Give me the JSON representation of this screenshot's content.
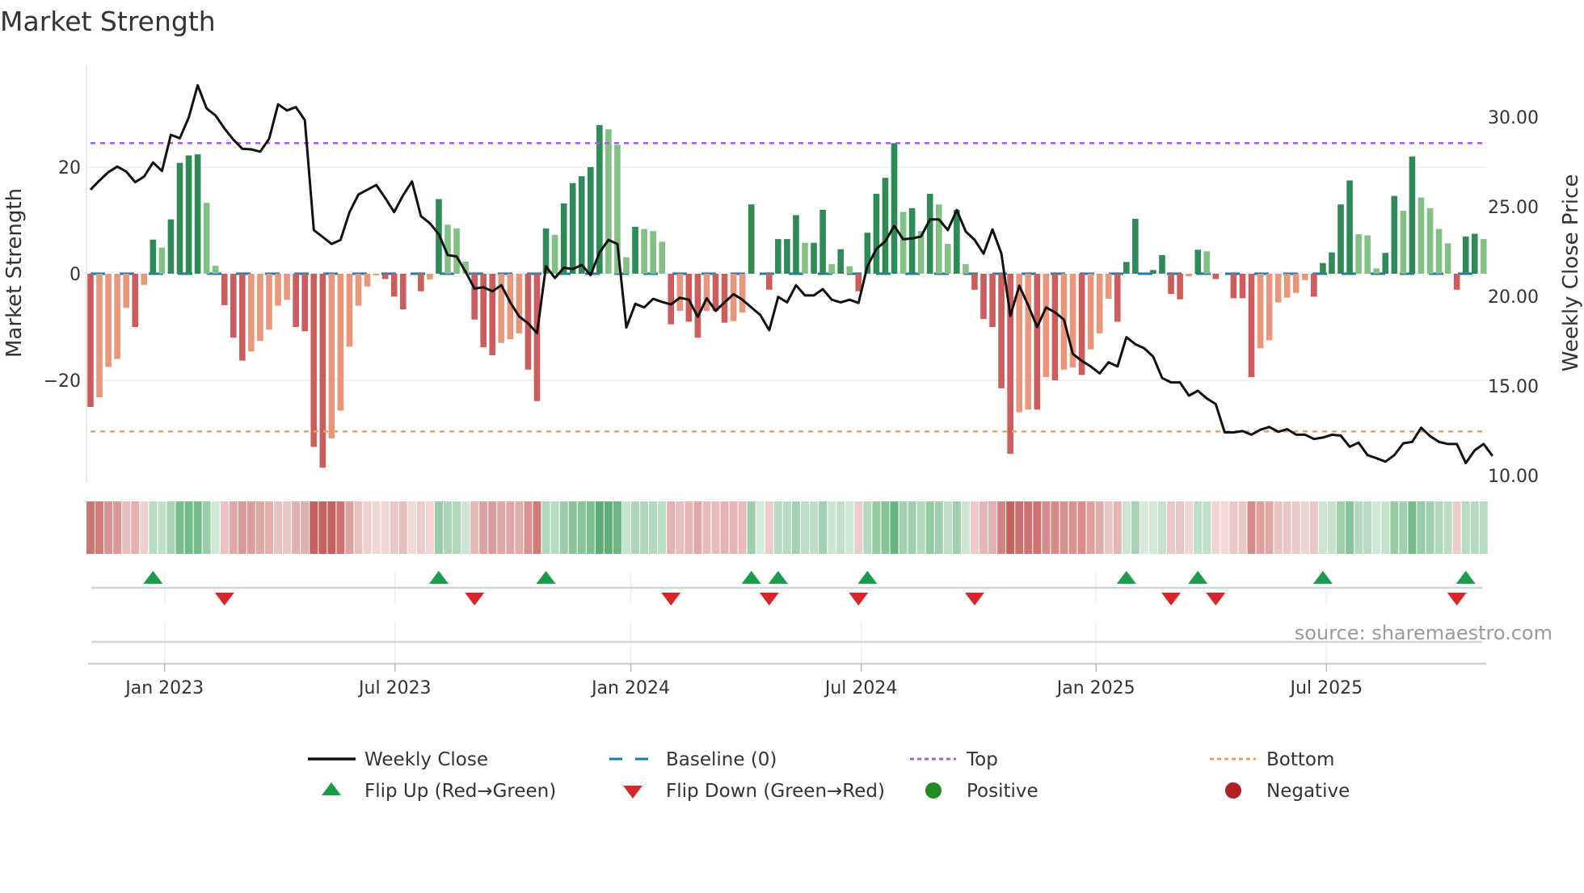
{
  "title": "Market Strength",
  "source": "source: sharemaestro.com",
  "chart_data": {
    "type": "bar",
    "title": "Market Strength",
    "ylabel": "Market Strength",
    "y2label": "Weekly Close Price",
    "ylim": [
      -39,
      39
    ],
    "y2lim": [
      9.6,
      32.9
    ],
    "yticks": [
      {
        "v": 20,
        "label": "20"
      },
      {
        "v": 0,
        "label": "0"
      },
      {
        "v": -20,
        "label": "−20"
      }
    ],
    "y2ticks": [
      {
        "v": 30,
        "label": "30.00"
      },
      {
        "v": 25,
        "label": "25.00"
      },
      {
        "v": 20,
        "label": "20.00"
      },
      {
        "v": 15,
        "label": "15.00"
      },
      {
        "v": 10,
        "label": "10.00"
      }
    ],
    "xticks": [
      {
        "week": 8.3,
        "label": "Jan 2023"
      },
      {
        "week": 34.1,
        "label": "Jul 2023"
      },
      {
        "week": 60.5,
        "label": "Jan 2024"
      },
      {
        "week": 86.3,
        "label": "Jul 2024"
      },
      {
        "week": 112.6,
        "label": "Jan 2025"
      },
      {
        "week": 138.4,
        "label": "Jul 2025"
      }
    ],
    "top_level": 24.5,
    "bottom_level": -29.6,
    "baseline": 0,
    "strength": [
      -25,
      -23.2,
      -17.5,
      -16,
      -6.4,
      -10,
      -2.1,
      6.4,
      4.9,
      10.2,
      20.8,
      22.2,
      22.4,
      13.3,
      1.5,
      -5.9,
      -12,
      -16.3,
      -14.6,
      -12.6,
      -10.5,
      -6,
      -4.9,
      -10,
      -10.8,
      -32.5,
      -36.4,
      -30.9,
      -25.7,
      -13.7,
      -6,
      -2.4,
      -0.3,
      -1,
      -4.3,
      -6.7,
      0,
      -3.3,
      -1.1,
      14,
      9.2,
      8.5,
      2.3,
      -8.6,
      -13.8,
      -15.3,
      -13,
      -12.3,
      -11.2,
      -18,
      -23.9,
      8.5,
      7.3,
      13.2,
      17,
      18.3,
      20,
      27.9,
      27.1,
      24.2,
      3.1,
      8.8,
      8.4,
      8,
      6,
      -9.5,
      -7,
      -9,
      -12,
      -7,
      -7,
      -9.2,
      -8.9,
      -7.3,
      13,
      0,
      -3,
      6.5,
      6.5,
      11,
      5.8,
      5.8,
      12,
      1.8,
      4.6,
      1.4,
      -3.3,
      7.7,
      15,
      18,
      24.5,
      11.6,
      12.3,
      8,
      15,
      13,
      5.6,
      12,
      1.8,
      -3,
      -8.5,
      -10,
      -21.5,
      -33.8,
      -26,
      -25.5,
      -25.5,
      -19.4,
      -20,
      -18,
      -17.6,
      -19,
      -14.2,
      -11.2,
      -4.7,
      -9,
      2.2,
      10.3,
      0,
      0.7,
      3.5,
      -3.8,
      -4.8,
      -0.5,
      4.5,
      4.2,
      -1,
      0,
      -4.6,
      -4.6,
      -19.4,
      -14,
      -12.5,
      -5.4,
      -4.5,
      -3.6,
      -1.2,
      -4.3,
      2,
      4,
      13,
      17.5,
      7.4,
      7.2,
      1,
      3.9,
      14.6,
      11.8,
      22,
      14.3,
      12.3,
      8.4,
      5.7,
      -3,
      7,
      7.5,
      6.5
    ],
    "weekly_close": [
      25.95,
      26.46,
      26.93,
      27.24,
      26.96,
      26.37,
      26.68,
      27.47,
      26.99,
      29.01,
      28.82,
      29.98,
      31.77,
      30.48,
      30.09,
      29.36,
      28.74,
      28.23,
      28.2,
      28.07,
      28.79,
      30.71,
      30.37,
      30.56,
      29.83,
      23.7,
      23.31,
      22.92,
      23.15,
      24.7,
      25.68,
      25.95,
      26.21,
      25.48,
      24.7,
      25.64,
      26.41,
      24.47,
      24.08,
      23.46,
      22.3,
      22.22,
      21.37,
      20.43,
      20.51,
      20.28,
      20.62,
      19.66,
      18.88,
      18.49,
      17.95,
      21.68,
      21.02,
      21.6,
      21.52,
      21.75,
      21.18,
      22.45,
      23.15,
      22.92,
      18.26,
      19.58,
      19.38,
      19.86,
      19.69,
      19.55,
      19.92,
      19.81,
      18.85,
      19.89,
      19.19,
      19.66,
      20.12,
      19.81,
      19.38,
      18.96,
      18.11,
      19.97,
      19.66,
      20.62,
      20.05,
      20.05,
      20.4,
      19.81,
      19.66,
      19.81,
      19.63,
      21.68,
      22.64,
      23.07,
      23.93,
      23.18,
      23.23,
      23.34,
      24.29,
      24.29,
      23.7,
      24.81,
      23.62,
      23.15,
      22.38,
      23.73,
      22.38,
      18.91,
      20.59,
      19.5,
      18.29,
      19.38,
      19.11,
      18.7,
      16.79,
      16.4,
      16.09,
      15.7,
      16.32,
      16.09,
      17.72,
      17.33,
      17.1,
      16.63,
      15.44,
      15.2,
      15.2,
      14.46,
      14.73,
      14.3,
      13.99,
      12.41,
      12.41,
      12.48,
      12.28,
      12.56,
      12.71,
      12.44,
      12.59,
      12.28,
      12.28,
      12.04,
      12.12,
      12.28,
      12.23,
      11.61,
      11.84,
      11.14,
      10.97,
      10.78,
      11.14,
      11.8,
      11.88,
      12.67,
      12.2,
      11.88,
      11.76,
      11.76,
      10.7,
      11.41,
      11.76,
      11.09
    ],
    "colors": {
      "pos_strong": "#2e8b57",
      "pos_weak": "#82c084",
      "neg_strong": "#cd5c5c",
      "neg_weak": "#e9967a",
      "line": "#111111",
      "baseline": "#1f77b4",
      "top": "#a35fd6",
      "bottom": "#f0a060",
      "flip_up": "#1a9c4a",
      "flip_down": "#d62728",
      "positive": "#228b22",
      "negative": "#b22222"
    },
    "legend": {
      "placement": "bottom",
      "items": [
        {
          "key": "line",
          "label": "Weekly Close"
        },
        {
          "key": "baseline",
          "label": "Baseline (0)"
        },
        {
          "key": "top",
          "label": "Top"
        },
        {
          "key": "bottom",
          "label": "Bottom"
        },
        {
          "key": "flip_up",
          "label": "Flip Up (Red→Green)"
        },
        {
          "key": "flip_down",
          "label": "Flip Down (Green→Red)"
        },
        {
          "key": "positive",
          "label": "Positive"
        },
        {
          "key": "negative",
          "label": "Negative"
        }
      ]
    }
  }
}
